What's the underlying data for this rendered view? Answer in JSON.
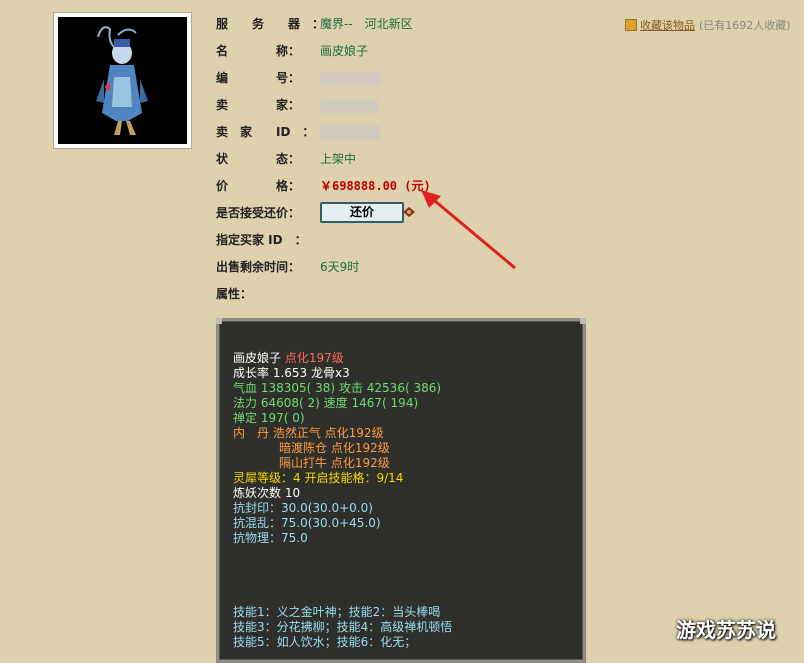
{
  "favorite": {
    "link": "收藏该物品",
    "count": "(已有1692人收藏)"
  },
  "fields": {
    "server_label": "服　　务　　器　：",
    "server_value": "魔界--　河北新区",
    "name_label": "名　　　　称：",
    "name_value": "画皮娘子",
    "id_label": "编　　　　号：",
    "seller_label": "卖　　　　家：",
    "seller_id_label": "卖　家　　ID　：",
    "status_label": "状　　　　态：",
    "status_value": "上架中",
    "price_label": "价　　　　格：",
    "price_value": "￥698888.00 (元)",
    "bargain_label": "是否接受还价：",
    "bargain_button": "还价",
    "buyer_label": "指定买家 ID　：",
    "remaining_label": "出售剩余时间：",
    "remaining_value": "6天9时",
    "attr_label": "属性："
  },
  "panel": {
    "name": "画皮娘子",
    "level": "点化197级",
    "growth": "成长率 1.653 龙骨x3",
    "hp_label": "气血",
    "hp": "138305( 38)",
    "atk_label": "攻击",
    "atk": "42536( 386)",
    "mp_label": "法力",
    "mp": "64608( 2)",
    "spd_label": "速度",
    "spd": "1467( 194)",
    "zen": "禅定 197( 0)",
    "neidan_label": "内　丹",
    "neidan_1": "浩然正气 点化192级",
    "neidan_2": "暗渡陈仓 点化192级",
    "neidan_3": "隔山打牛 点化192级",
    "rhino": "灵犀等级：4 开启技能格：9/14",
    "refine": "炼妖次数 10",
    "res_seal": "抗封印：30.0(30.0+0.0)",
    "res_chaos": "抗混乱：75.0(30.0+45.0)",
    "res_phys": "抗物理：75.0",
    "skills_1": "技能1：义之金叶神；技能2：当头棒喝",
    "skills_2": "技能3：分花拂柳；技能4：高级禅机顿悟",
    "skills_3": "技能5：如人饮水；技能6：化无；"
  },
  "watermark": "游戏苏苏说",
  "colors": {
    "price": "#c00000",
    "value_green": "#1f6b3a",
    "panel_bg": "#2e2f2b",
    "arrow": "#e02020"
  }
}
